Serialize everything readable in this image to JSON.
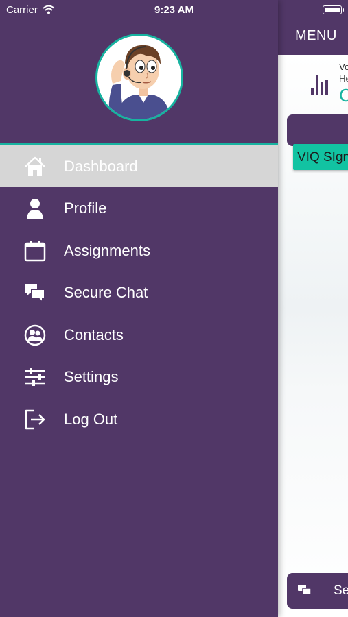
{
  "status_bar": {
    "carrier": "Carrier",
    "time": "9:23 AM"
  },
  "header": {
    "menu_label": "MENU"
  },
  "background_pane": {
    "stat_line1": "Vo",
    "stat_line2": "He",
    "stat_value": "C",
    "teal_bar_text": "VIQ SIgn",
    "bottom_button_text": "Se"
  },
  "drawer": {
    "items": [
      {
        "label": "Dashboard",
        "icon": "home-icon",
        "active": true
      },
      {
        "label": "Profile",
        "icon": "user-icon",
        "active": false
      },
      {
        "label": "Assignments",
        "icon": "calendar-icon",
        "active": false
      },
      {
        "label": "Secure Chat",
        "icon": "chat-icon",
        "active": false
      },
      {
        "label": "Contacts",
        "icon": "contacts-icon",
        "active": false
      },
      {
        "label": "Settings",
        "icon": "sliders-icon",
        "active": false
      },
      {
        "label": "Log Out",
        "icon": "logout-icon",
        "active": false
      }
    ]
  },
  "colors": {
    "primary": "#513767",
    "accent": "#17b3a0",
    "active_item_bg": "#d6d6d6"
  }
}
